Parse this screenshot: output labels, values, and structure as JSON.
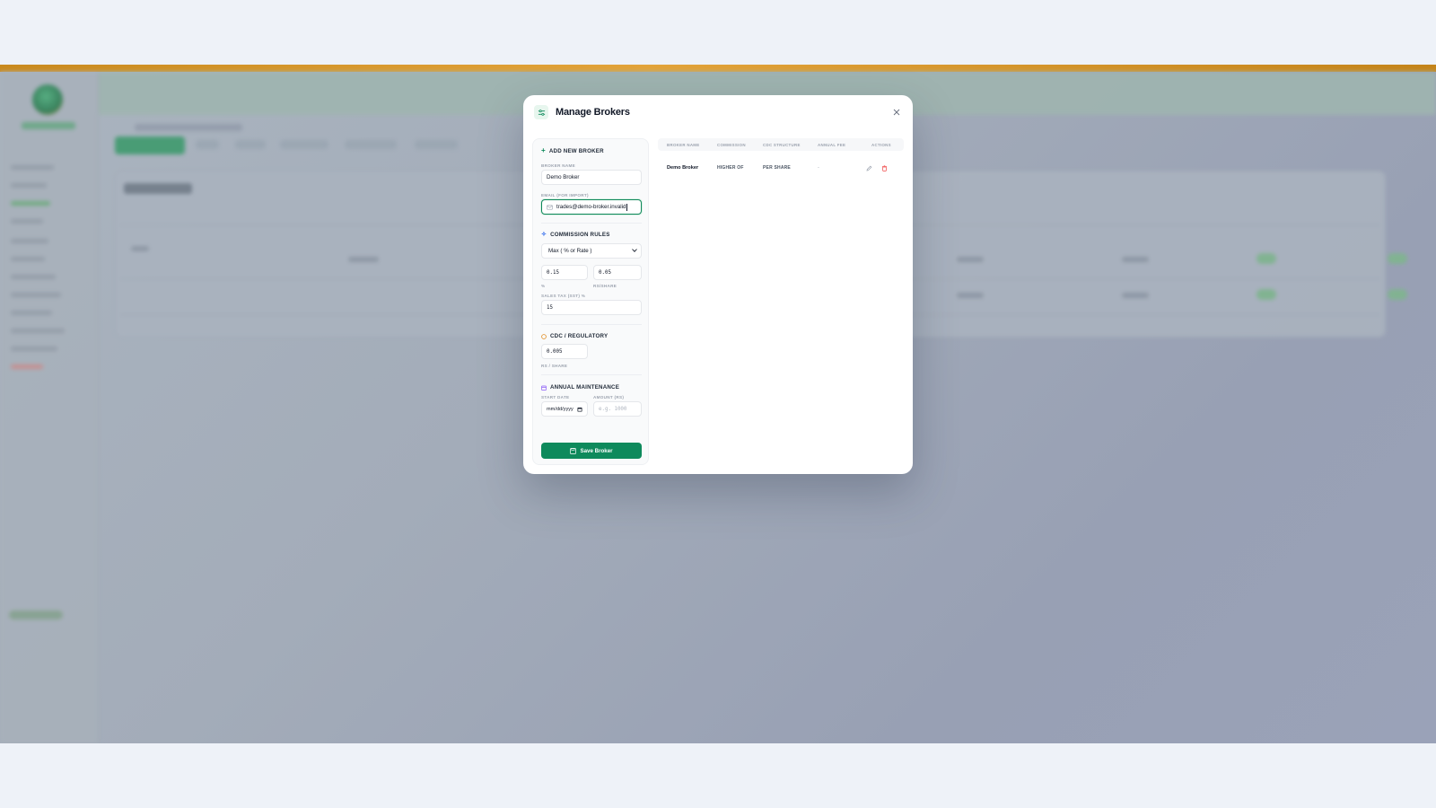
{
  "modal": {
    "title": "Manage Brokers",
    "close_icon": "close-icon",
    "header_icon": "sliders-icon"
  },
  "form": {
    "section_title": "ADD NEW BROKER",
    "broker_name_label": "BROKER NAME",
    "broker_name_value": "Demo Broker",
    "email_label": "EMAIL (FOR IMPORT)",
    "email_value": "trades@demo-broker.invalid",
    "commission_title": "COMMISSION RULES",
    "commission_type": "Max ( % or Rate )",
    "percent_value": "0.15",
    "percent_note": "%",
    "rate_value": "0.05",
    "rate_note": "RS/SHARE",
    "sales_tax_label": "SALES TAX (SST) %",
    "sales_tax_value": "15",
    "cdc_title": "CDC / REGULATORY",
    "cdc_value": "0.005",
    "cdc_note": "RS / SHARE",
    "maintenance_title": "ANNUAL MAINTENANCE",
    "start_date_label": "START DATE",
    "start_date_placeholder": "mm/dd/yyyy",
    "amount_label": "AMOUNT (RS)",
    "amount_placeholder": "e.g. 1000",
    "save_label": "Save Broker"
  },
  "table": {
    "headers": [
      "BROKER NAME",
      "COMMISSION",
      "CDC STRUCTURE",
      "ANNUAL FEE",
      "ACTIONS"
    ],
    "rows": [
      {
        "name": "Demo Broker",
        "commission": "HIGHER OF",
        "cdc": "PER SHARE",
        "annual_fee": "-"
      }
    ]
  },
  "colors": {
    "accent": "#0e8a5c",
    "top_bar": "#d99a2b",
    "delete": "#ef4444"
  }
}
